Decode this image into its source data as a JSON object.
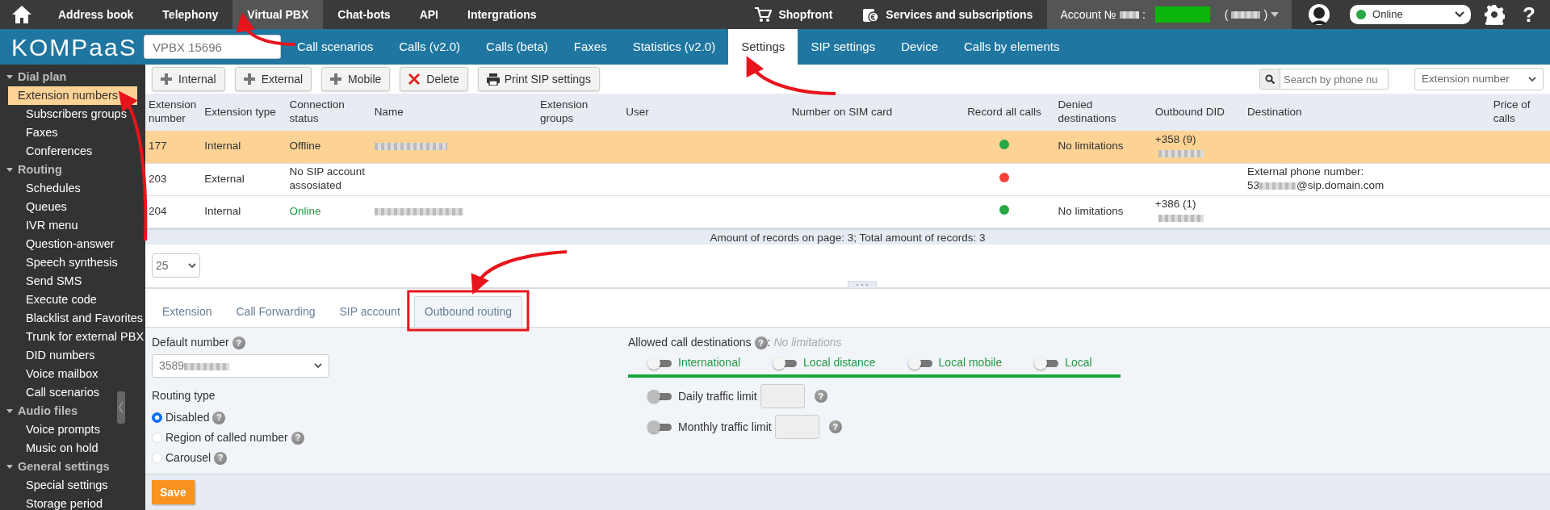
{
  "top_nav": {
    "items": [
      {
        "label": "Address book",
        "selected": false
      },
      {
        "label": "Telephony",
        "selected": false
      },
      {
        "label": "Virtual PBX",
        "selected": true
      },
      {
        "label": "Chat-bots",
        "selected": false
      },
      {
        "label": "API",
        "selected": false
      },
      {
        "label": "Intergrations",
        "selected": false
      }
    ],
    "shopfront": "Shopfront",
    "services": "Services and subscriptions",
    "account": {
      "prefix": "Account №",
      "colon": ":",
      "paren_open": "(",
      "paren_close": ")"
    },
    "status": {
      "value": "Online",
      "color": "#28a745"
    },
    "help": "?"
  },
  "sub_nav": {
    "logo": "KOMPaaS",
    "vpbx_placeholder": "VPBX 15696",
    "tabs": [
      {
        "label": "Call scenarios",
        "selected": false
      },
      {
        "label": "Calls (v2.0)",
        "selected": false
      },
      {
        "label": "Calls (beta)",
        "selected": false
      },
      {
        "label": "Faxes",
        "selected": false
      },
      {
        "label": "Statistics (v2.0)",
        "selected": false
      },
      {
        "label": "Settings",
        "selected": true
      },
      {
        "label": "SIP settings",
        "selected": false
      },
      {
        "label": "Device",
        "selected": false
      },
      {
        "label": "Calls by elements",
        "selected": false
      }
    ]
  },
  "sidebar": [
    {
      "label": "Dial plan",
      "expanded": true,
      "items": [
        {
          "label": "Extension numbers",
          "selected": true
        },
        {
          "label": "Subscribers groups",
          "selected": false
        },
        {
          "label": "Faxes",
          "selected": false
        },
        {
          "label": "Conferences",
          "selected": false
        }
      ]
    },
    {
      "label": "Routing",
      "expanded": true,
      "items": [
        {
          "label": "Schedules",
          "selected": false
        },
        {
          "label": "Queues",
          "selected": false
        },
        {
          "label": "IVR menu",
          "selected": false
        },
        {
          "label": "Question-answer",
          "selected": false
        },
        {
          "label": "Speech synthesis",
          "selected": false
        },
        {
          "label": "Send SMS",
          "selected": false
        },
        {
          "label": "Execute code",
          "selected": false
        },
        {
          "label": "Blacklist and Favorites",
          "selected": false
        },
        {
          "label": "Trunk for external PBX",
          "selected": false
        },
        {
          "label": "DID numbers",
          "selected": false
        },
        {
          "label": "Voice mailbox",
          "selected": false
        },
        {
          "label": "Call scenarios",
          "selected": false
        }
      ]
    },
    {
      "label": "Audio files",
      "expanded": true,
      "items": [
        {
          "label": "Voice prompts",
          "selected": false
        },
        {
          "label": "Music on hold",
          "selected": false
        }
      ]
    },
    {
      "label": "General settings",
      "expanded": true,
      "items": [
        {
          "label": "Special settings",
          "selected": false
        },
        {
          "label": "Storage period",
          "selected": false
        }
      ]
    }
  ],
  "toolbar": {
    "buttons": [
      {
        "label": "Internal",
        "kind": "plus"
      },
      {
        "label": "External",
        "kind": "plus"
      },
      {
        "label": "Mobile",
        "kind": "plus"
      },
      {
        "label": "Delete",
        "kind": "delete"
      },
      {
        "label": "Print SIP settings",
        "kind": "print"
      }
    ],
    "search_placeholder": "Search by phone nu",
    "filter": "Extension number"
  },
  "table": {
    "columns": [
      "Extension number",
      "Extension type",
      "Connection status",
      "Name",
      "Extension groups",
      "User",
      "Number on SIM card",
      "Record all calls",
      "Denied destinations",
      "Outbound DID",
      "Destination",
      "Price of calls"
    ],
    "rows": [
      {
        "selected": true,
        "number": "177",
        "type": "Internal",
        "status": "Offline",
        "online": false,
        "name_redacted": true,
        "color": "#28a745",
        "denied": "No limitations",
        "did": "+358 (9)",
        "did_redacted": true
      },
      {
        "selected": false,
        "number": "203",
        "type": "External",
        "status": "No SIP account assosiated",
        "online": false,
        "name_redacted": false,
        "color": "#f44336",
        "destination_label": "External phone number:",
        "destination_prefix": "53",
        "destination_suffix": "@sip.domain.com"
      },
      {
        "selected": false,
        "number": "204",
        "type": "Internal",
        "status": "Online",
        "online": true,
        "name_redacted": true,
        "color": "#28a745",
        "denied": "No limitations",
        "did": "+386 (1)",
        "did_redacted": true
      }
    ],
    "footer": "Amount of records on page: 3; Total amount of records: 3"
  },
  "page_size": "25",
  "detail_tabs": [
    {
      "label": "Extension",
      "selected": false
    },
    {
      "label": "Call Forwarding",
      "selected": false
    },
    {
      "label": "SIP account",
      "selected": false
    },
    {
      "label": "Outbound routing",
      "selected": true
    }
  ],
  "outbound": {
    "default_number_label": "Default number",
    "default_number_help": "?",
    "default_number": "3589",
    "routing_type_label": "Routing type",
    "routing_types": [
      {
        "label": "Disabled",
        "selected": true,
        "help": "?"
      },
      {
        "label": "Region of called number",
        "selected": false,
        "help": "?"
      },
      {
        "label": "Carousel",
        "selected": false,
        "help": "?"
      }
    ],
    "allowed_label": "Allowed call destinations",
    "allowed_help": "?",
    "allowed_colon": ":",
    "allowed_note": "No limitations",
    "destinations": [
      {
        "label": "International",
        "on": false
      },
      {
        "label": "Local distance",
        "on": false
      },
      {
        "label": "Local mobile",
        "on": false
      },
      {
        "label": "Local",
        "on": false
      }
    ],
    "limits": [
      {
        "label": "Daily traffic limit",
        "on": false,
        "help": "?"
      },
      {
        "label": "Monthly traffic limit",
        "on": false,
        "help": "?"
      }
    ]
  },
  "save": "Save"
}
